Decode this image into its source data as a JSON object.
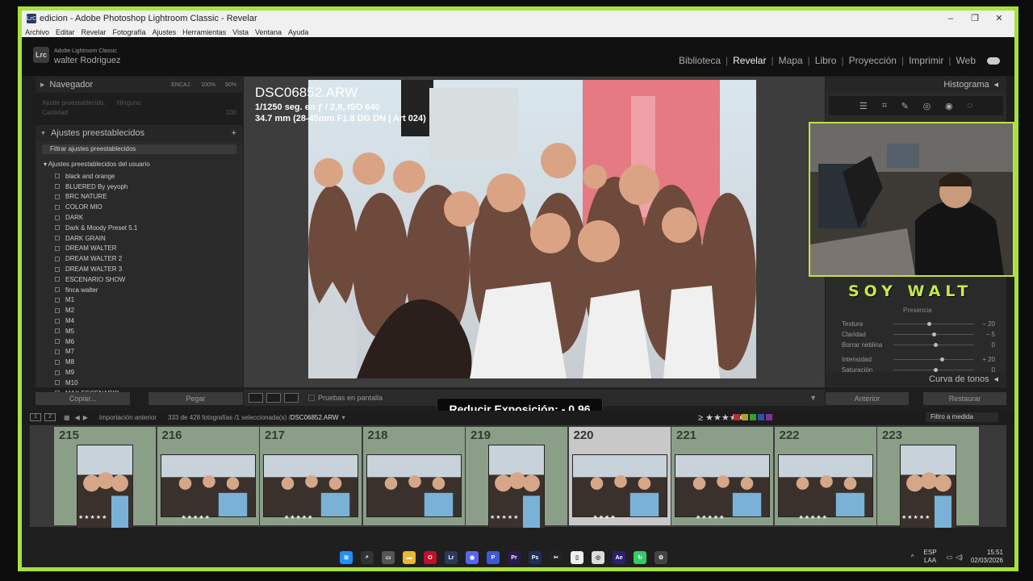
{
  "window": {
    "title": "edicion - Adobe Photoshop Lightroom Classic - Revelar",
    "app_badge": "LrC",
    "controls": [
      "–",
      "❐",
      "✕"
    ]
  },
  "menu": [
    "Archivo",
    "Editar",
    "Revelar",
    "Fotografía",
    "Ajustes",
    "Herramientas",
    "Vista",
    "Ventana",
    "Ayuda"
  ],
  "identity": {
    "logo": "Lrc",
    "line1": "Adobe Lightroom Classic",
    "line2": "walter Rodriguez"
  },
  "modules": [
    {
      "label": "Biblioteca",
      "active": false
    },
    {
      "label": "Revelar",
      "active": true
    },
    {
      "label": "Mapa",
      "active": false
    },
    {
      "label": "Libro",
      "active": false
    },
    {
      "label": "Proyección",
      "active": false
    },
    {
      "label": "Imprimir",
      "active": false
    },
    {
      "label": "Web",
      "active": false
    }
  ],
  "left_panel": {
    "navigator": "Navegador",
    "navigator_zoom": [
      "ENCAJ.",
      "100%",
      "50%"
    ],
    "preset_amount_label": "Ajuste preestablecido:",
    "preset_amount_value": "Ninguno",
    "amount_label": "Cantidad",
    "amount_value": "100",
    "presets_header": "Ajustes preestablecidos",
    "presets_add": "+",
    "filter": "Filtrar ajustes preestablecidos",
    "group": "Ajustes preestablecidos del usuario",
    "items": [
      "black and orange",
      "BLUERED By yeyoph",
      "BRC NATURE",
      "COLOR MIO",
      "DARK",
      "Dark & Moody Preset 5.1",
      "DARK GRAIN",
      "DREAM WALTER",
      "DREAM WALTER 2",
      "DREAM WALTER 3",
      "ESCENARIO SHOW",
      "finca walter",
      "M1",
      "M2",
      "M4",
      "M5",
      "M6",
      "M7",
      "M8",
      "M9",
      "M10",
      "MAX ESCENARIO"
    ],
    "copy_btn": "Copiar...",
    "paste_btn": "Pegar"
  },
  "photo_info": {
    "filename": "DSC06852.ARW",
    "exposure": "1/1250 seg. en ƒ / 2,8, ISO 640",
    "lens": "34.7 mm (28-45mm F1.8 DG DN | Art 024)"
  },
  "toolbar": {
    "soft_proof": "Pruebas en pantalla"
  },
  "right_panel": {
    "histogram": "Histograma",
    "tools": [
      "☰",
      "⌗",
      "✎",
      "◎",
      "◉",
      "◌"
    ],
    "presence": "Presencia",
    "sliders": [
      {
        "label": "Textura",
        "value": "– 20",
        "pos": 0.42
      },
      {
        "label": "Claridad",
        "value": "– 5",
        "pos": 0.48
      },
      {
        "label": "Borrar neblina",
        "value": "0",
        "pos": 0.5
      },
      {
        "label": "Intensidad",
        "value": "+ 20",
        "pos": 0.58
      },
      {
        "label": "Saturación",
        "value": "0",
        "pos": 0.5
      }
    ],
    "tone_curve": "Curva de tonos",
    "prev_btn": "Anterior",
    "reset_btn": "Restaurar"
  },
  "overlay": {
    "streamer_name": "SOY WALT",
    "toast": "Reducir Exposición: - 0,96"
  },
  "filmstrip_bar": {
    "pages": [
      "1",
      "2"
    ],
    "source": "Importación anterior",
    "count": "333 de 428 fotografías /1 seleccionada(s) /",
    "current_file": "DSC06852.ARW",
    "stars": "≥ ★★★★★",
    "filter": "Filtro a medida",
    "swatch_colors": [
      "#b03030",
      "#b0a030",
      "#30a030",
      "#3050b0",
      "#8030a0"
    ]
  },
  "filmstrip": [
    {
      "num": "215",
      "stars": "★★★★★",
      "selected": false
    },
    {
      "num": "216",
      "stars": "★★★★★",
      "selected": false
    },
    {
      "num": "217",
      "stars": "★★★★★",
      "selected": false
    },
    {
      "num": "218",
      "stars": "",
      "selected": false
    },
    {
      "num": "219",
      "stars": "★★★★★",
      "selected": false
    },
    {
      "num": "220",
      "stars": "★★★★",
      "selected": true
    },
    {
      "num": "221",
      "stars": "★★★★★",
      "selected": false
    },
    {
      "num": "222",
      "stars": "★★★★★",
      "selected": false
    },
    {
      "num": "223",
      "stars": "★★★★★",
      "selected": false
    }
  ],
  "taskbar": {
    "apps": [
      "windows-icon",
      "search-icon",
      "taskview-icon",
      "explorer-icon",
      "opera-icon",
      "lightroom-icon",
      "discord-icon",
      "ps-icon",
      "premiere-icon",
      "photoshop-icon",
      "capcut-icon",
      "notepad-icon",
      "chrome-icon",
      "aftereffects-icon",
      "app-icon",
      "settings-icon"
    ],
    "lang_1": "ESP",
    "lang_2": "LAA",
    "time": "15:51",
    "date": "02/03/2026"
  }
}
